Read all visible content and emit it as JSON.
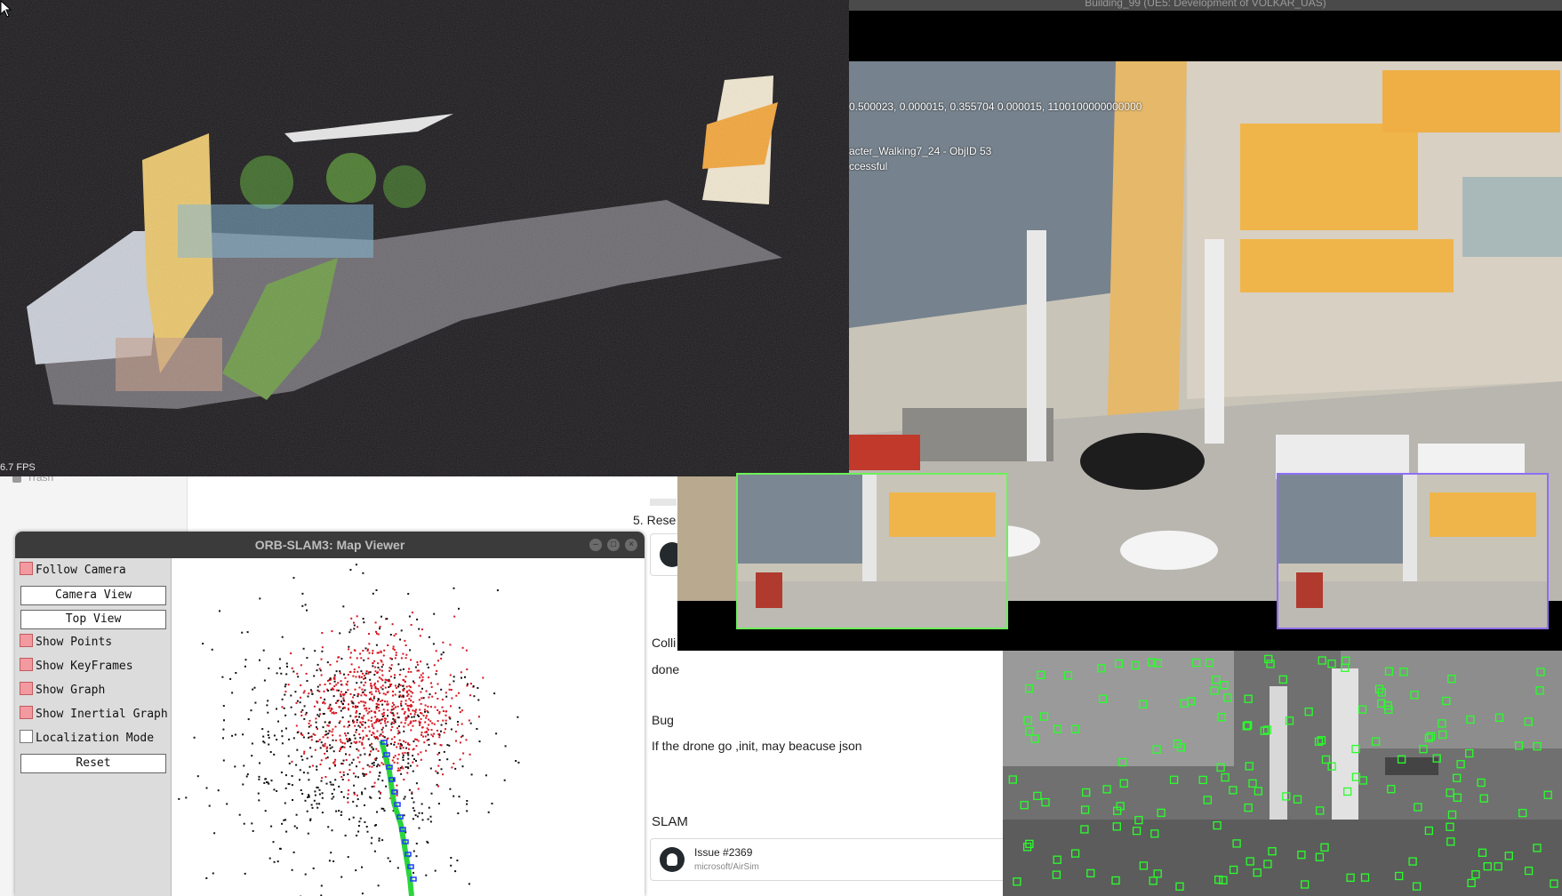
{
  "sidebar": {
    "trash_label": "Trash"
  },
  "notes": {
    "list_item_number": "5.",
    "list_item_text": "Rese",
    "collision_text": "Colli",
    "done_text": "done",
    "bug_heading": "Bug",
    "bug_text": "If the drone go ,init, may beacuse json",
    "slam_heading": "SLAM",
    "issue_card": {
      "title": "Issue #2369",
      "subtitle": "microsoft/AirSim",
      "icon": "github-icon"
    }
  },
  "pointcloud_viewer": {
    "fps": "6.7 FPS"
  },
  "simulation": {
    "window_title": "Building_99 (UE5: Development of VOLKAR_UAS)",
    "overlay_lines": [
      "0.500023, 0.000015, 0.355704 0.000015, 1100100000000000",
      "acter_Walking7_24 - ObjID 53",
      "ccessful"
    ]
  },
  "orb_viewer": {
    "title": "ORB-SLAM3: Map Viewer",
    "controls": {
      "follow_camera": "Follow Camera",
      "camera_view": "Camera View",
      "top_view": "Top View",
      "show_points": "Show Points",
      "show_keyframes": "Show KeyFrames",
      "show_graph": "Show Graph",
      "show_inertial_graph": "Show Inertial Graph",
      "localization_mode": "Localization Mode",
      "reset": "Reset"
    },
    "checkbox_states": {
      "follow_camera": true,
      "show_points": true,
      "show_keyframes": true,
      "show_graph": true,
      "show_inertial_graph": true,
      "localization_mode": false
    },
    "colors": {
      "map_point": "#d7141e",
      "ref_point": "#111111",
      "trajectory": "#2bd43b",
      "keyframe": "#1f3bff"
    }
  },
  "feature_view": {
    "marker_color": "#29ff2b"
  }
}
